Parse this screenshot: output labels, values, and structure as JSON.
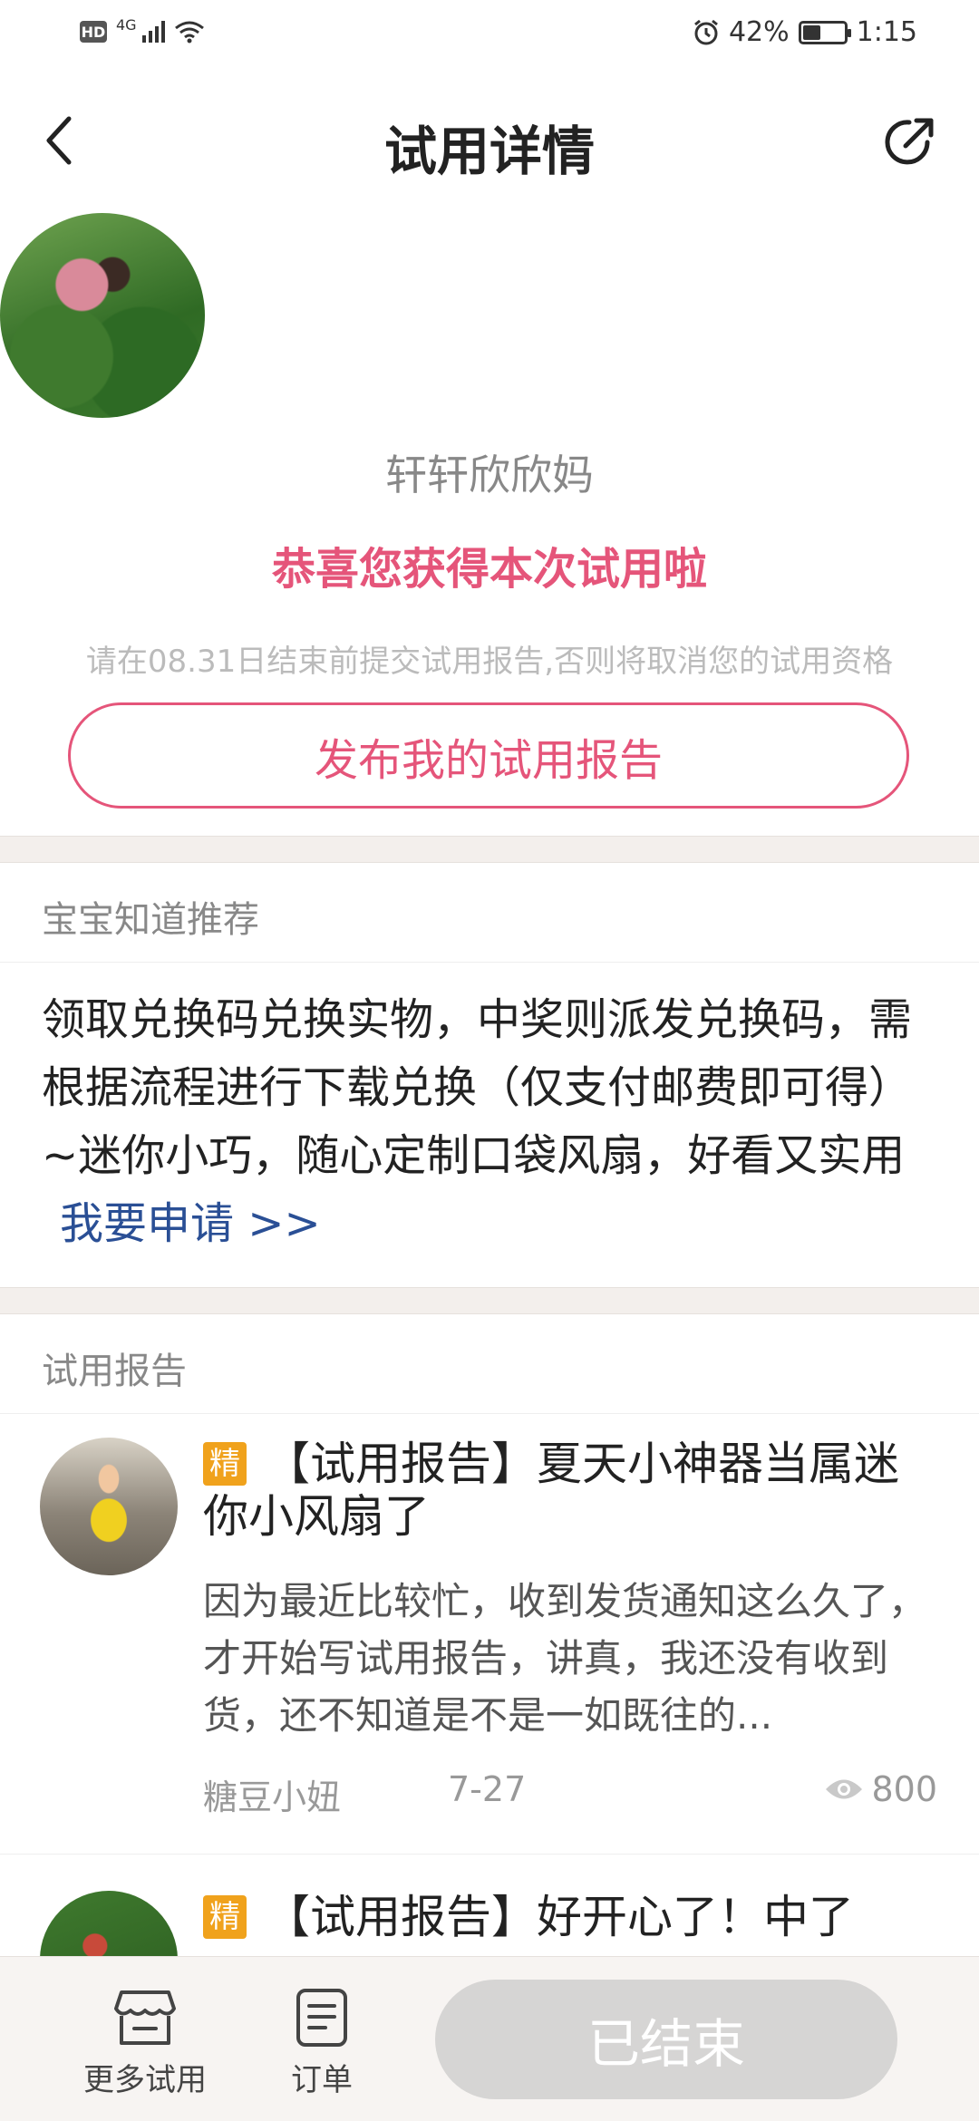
{
  "status_bar": {
    "network_badge": "HD",
    "network_type": "4G",
    "battery": "42%",
    "time": "1:15"
  },
  "nav": {
    "title": "试用详情"
  },
  "winner": {
    "username": "轩轩欣欣妈",
    "congrats": "恭喜您获得本次试用啦",
    "notice": "请在08.31日结束前提交试用报告,否则将取消您的试用资格",
    "publish_button": "发布我的试用报告"
  },
  "recommend": {
    "header": "宝宝知道推荐",
    "text": "领取兑换码兑换实物，中奖则派发兑换码，需根据流程进行下载兑换（仅支付邮费即可得）~迷你小巧，随心定制口袋风扇，好看又实用",
    "apply_link": "我要申请 >>"
  },
  "reports": {
    "header": "试用报告",
    "items": [
      {
        "badge": "精",
        "title": "【试用报告】夏天小神器当属迷你小风扇了",
        "excerpt": "因为最近比较忙，收到发货通知这么久了，才开始写试用报告，讲真，我还没有收到货，还不知道是不是一如既往的...",
        "author": "糖豆小妞",
        "date": "7-27",
        "views": "800"
      },
      {
        "badge": "精",
        "title": "【试用报告】好开心了！中了"
      }
    ]
  },
  "bottom_bar": {
    "more_trials": "更多试用",
    "orders": "订单",
    "ended_button": "已结束"
  }
}
